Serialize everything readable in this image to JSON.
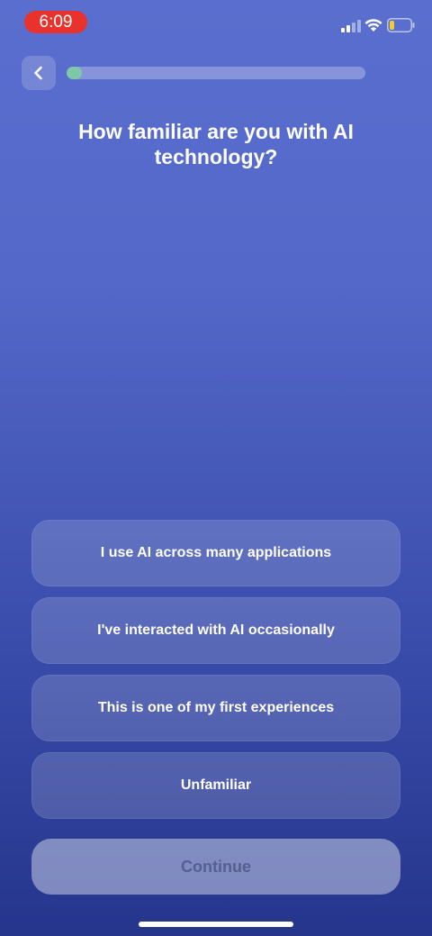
{
  "status_bar": {
    "time": "6:09",
    "time_pill_color": "#e8322b",
    "signal_icon": "signal-bars-icon",
    "wifi_icon": "wifi-icon",
    "battery_icon": "battery-low-icon"
  },
  "header": {
    "back_icon": "chevron-left-icon",
    "progress_fraction": 0.05,
    "progress_color": "#7ec7a8"
  },
  "question": "How familiar are you with AI technology?",
  "options": [
    {
      "label": "I use AI across many applications"
    },
    {
      "label": "I've interacted with AI occasionally"
    },
    {
      "label": "This is one of my first experiences"
    },
    {
      "label": "Unfamiliar"
    }
  ],
  "continue_label": "Continue"
}
